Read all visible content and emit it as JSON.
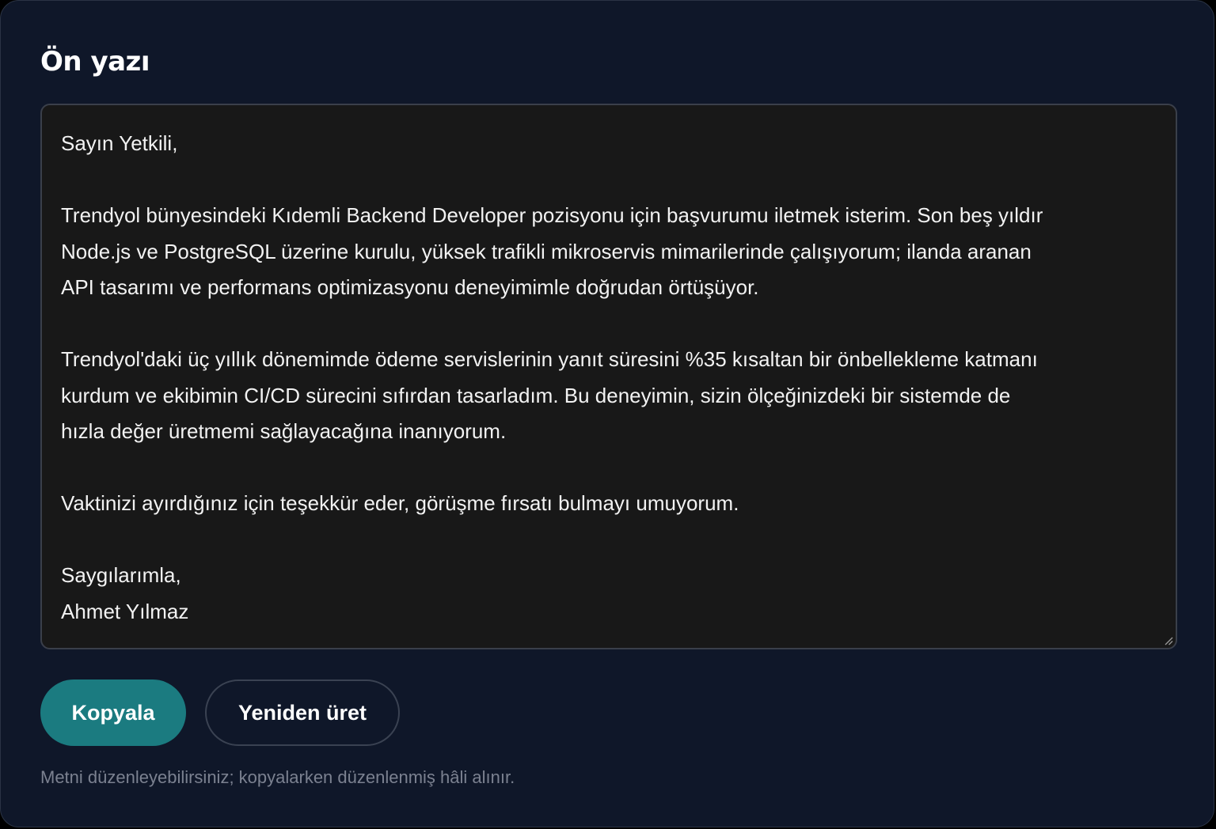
{
  "header": {
    "title": "Ön yazı"
  },
  "editor": {
    "lines": [
      "Sayın Yetkili,",
      "",
      "Trendyol bünyesindeki Kıdemli Backend Developer pozisyonu için başvurumu iletmek isterim. Son beş yıldır",
      "Node.js ve PostgreSQL üzerine kurulu, yüksek trafikli mikroservis mimarilerinde çalışıyorum; ilanda aranan",
      "API tasarımı ve performans optimizasyonu deneyimimle doğrudan örtüşüyor.",
      "",
      "Trendyol'daki üç yıllık dönemimde ödeme servislerinin yanıt süresini %35 kısaltan bir önbellekleme katmanı",
      "kurdum ve ekibimin CI/CD sürecini sıfırdan tasarladım. Bu deneyimin, sizin ölçeğinizdeki bir sistemde de",
      "hızla değer üretmemi sağlayacağına inanıyorum.",
      "",
      "Vaktinizi ayırdığınız için teşekkür eder, görüşme fırsatı bulmayı umuyorum.",
      "",
      "Saygılarımla,",
      "Ahmet Yılmaz"
    ]
  },
  "actions": {
    "copy_label": "Kopyala",
    "regenerate_label": "Yeniden üret"
  },
  "hint": "Metni düzenleyebilirsiniz; kopyalarken düzenlenmiş hâli alınır.",
  "colors": {
    "card_background": "#0f1729",
    "editor_background": "#181818",
    "primary_button": "#1b7b80",
    "hint_text": "#7b8190"
  }
}
